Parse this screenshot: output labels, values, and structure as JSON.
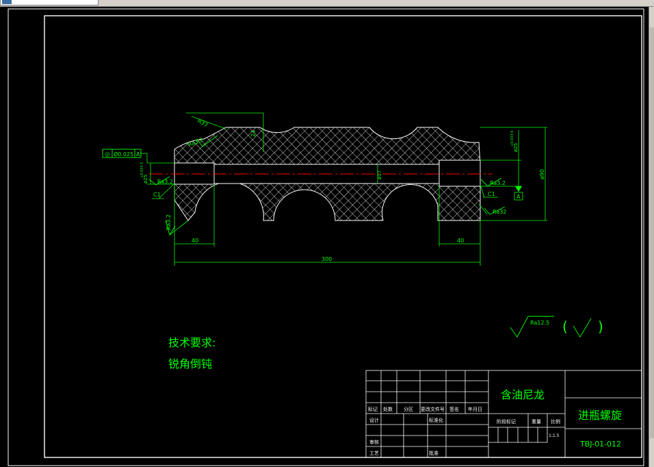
{
  "drawing": {
    "dimensions": {
      "radius_top": "R37",
      "depth": "24",
      "outer_diameter": "ø90",
      "inner_diameter": "ø17",
      "right_bore": "ø25",
      "left_bore": "ø25",
      "left_len": "40",
      "right_len": "40",
      "total_len": "300",
      "chamfer_left": "C1",
      "chamfer_right": "C1"
    },
    "tolerances": {
      "right_bore_tol": "+0.033 0",
      "left_bore_tol": "+0.033 0"
    },
    "roughness": {
      "ra_top": "Ra3.2",
      "ra_left": "Ra3.2",
      "ra_right": "Ra3.2",
      "ra_bottom_left": "Ra3.2",
      "ra_bottom_right": "Ra32",
      "general": "Ra12.5",
      "paren_open": "(",
      "paren_close": ")"
    },
    "geometric_tolerance": {
      "symbol": "◎",
      "value": "Ø0.025",
      "datum": "A"
    },
    "datum_label": "A",
    "tech_title": "技术要求:",
    "tech_note": "锐角倒钝"
  },
  "title_block": {
    "material": "含油尼龙",
    "part_name": "进瓶螺旋",
    "drawing_no": "TBJ-01-012",
    "scale": "1:1.5",
    "rev_headers": [
      "标记",
      "处数",
      "分区",
      "更改文件号",
      "签名",
      "年月日"
    ],
    "design": "设计",
    "standardize": "标准化",
    "stage_mark": "阶段标记",
    "weight": "重量",
    "ratio": "比例",
    "review": "审核",
    "process": "工艺",
    "approve": "批准"
  },
  "colors": {
    "line": "#ffffff",
    "dim": "#00ff00",
    "center": "#ff0000",
    "background": "#000000"
  }
}
